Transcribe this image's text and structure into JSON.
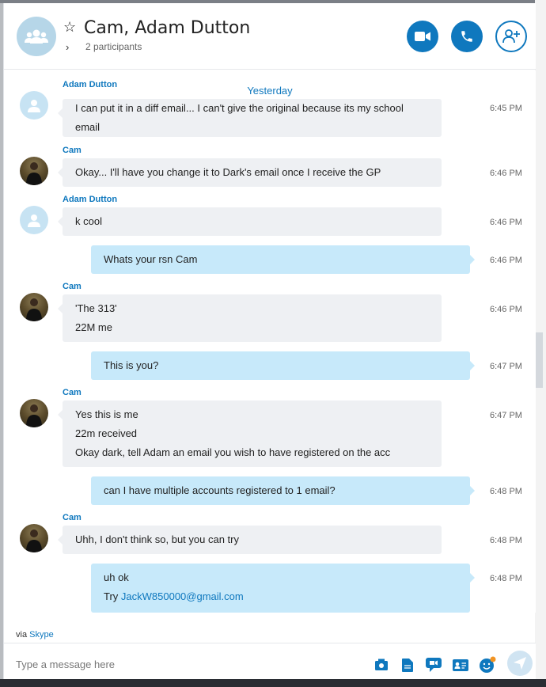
{
  "header": {
    "title": "Cam, Adam Dutton",
    "participants": "2 participants"
  },
  "chat": {
    "date_divider": "Yesterday",
    "partial_message": {
      "sender": "Adam Dutton",
      "lines": [
        "I can put it in a diff email... I can't give the original because its my school",
        "email"
      ],
      "time": "6:45 PM"
    },
    "messages": [
      {
        "direction": "in",
        "sender": "Cam",
        "avatar": "photo",
        "lines": [
          "Okay... I'll have you change it to Dark's email once I receive the GP"
        ],
        "time": "6:46 PM"
      },
      {
        "direction": "in",
        "sender": "Adam Dutton",
        "avatar": "default",
        "lines": [
          "k cool"
        ],
        "time": "6:46 PM"
      },
      {
        "direction": "out",
        "lines": [
          "Whats your rsn Cam"
        ],
        "time": "6:46 PM"
      },
      {
        "direction": "in",
        "sender": "Cam",
        "avatar": "photo",
        "lines": [
          "'The 313'",
          "22M me"
        ],
        "time": "6:46 PM"
      },
      {
        "direction": "out",
        "lines": [
          "This is you?"
        ],
        "time": "6:47 PM"
      },
      {
        "direction": "in",
        "sender": "Cam",
        "avatar": "photo",
        "lines": [
          "Yes this is me",
          "22m received",
          "Okay dark, tell Adam an email you wish to have registered on the acc"
        ],
        "time": "6:47 PM"
      },
      {
        "direction": "out",
        "lines": [
          "can I have multiple accounts registered to 1 email?"
        ],
        "time": "6:48 PM"
      },
      {
        "direction": "in",
        "sender": "Cam",
        "avatar": "photo",
        "lines": [
          "Uhh, I don't think so, but you can try"
        ],
        "time": "6:48 PM"
      },
      {
        "direction": "out",
        "lines": [
          "uh ok"
        ],
        "link_line": {
          "prefix": "Try ",
          "link": "JackW850000@gmail.com"
        },
        "time": "6:48 PM"
      }
    ]
  },
  "footer": {
    "via_prefix": "via",
    "via_link": "Skype",
    "placeholder": "Type a message here"
  },
  "icons": {
    "group": "group-avatar-icon",
    "video": "video-camera-icon",
    "call": "phone-icon",
    "add": "add-person-icon",
    "media": "media-gallery-icon",
    "file": "file-icon",
    "video_message": "video-message-icon",
    "contact": "contact-card-icon",
    "emoji": "emoji-icon",
    "send": "send-icon"
  },
  "colors": {
    "accent": "#0f78be",
    "incoming_bubble": "#eef0f3",
    "outgoing_bubble": "#c7e9fa"
  }
}
